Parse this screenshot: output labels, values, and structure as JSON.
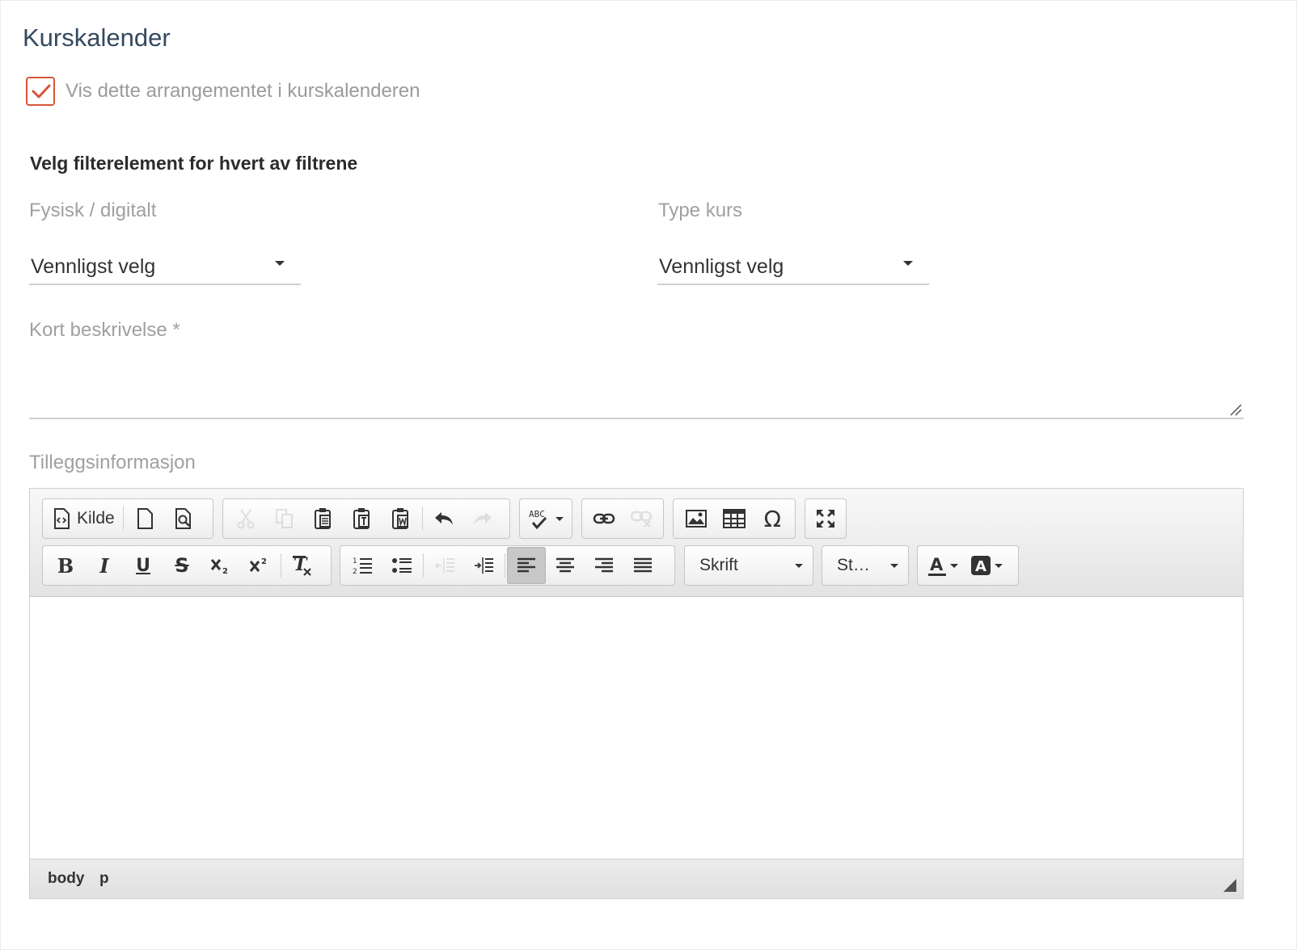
{
  "section": {
    "title": "Kurskalender"
  },
  "show_in_calendar": {
    "label": "Vis dette arrangementet i kurskalenderen",
    "checked": true,
    "accent": "#d6553a"
  },
  "filters": {
    "title": "Velg filterelement for hvert av filtrene",
    "physical_digital": {
      "label": "Fysisk / digitalt",
      "value": "Vennligst velg"
    },
    "course_type": {
      "label": "Type kurs",
      "value": "Vennligst velg"
    }
  },
  "short_description": {
    "label": "Kort beskrivelse *",
    "value": ""
  },
  "additional_info": {
    "label": "Tilleggsinformasjon",
    "toolbar": {
      "source_label": "Kilde",
      "font_label": "Skrift",
      "size_label": "St…",
      "row1_icons": [
        "source-icon",
        "new-page-icon",
        "preview-icon",
        "cut-icon",
        "copy-icon",
        "paste-icon",
        "paste-text-icon",
        "paste-word-icon",
        "undo-icon",
        "redo-icon",
        "spellcheck-icon",
        "link-icon",
        "unlink-icon",
        "image-icon",
        "table-icon",
        "special-char-icon",
        "maximize-icon"
      ],
      "row2_icons": [
        "bold-icon",
        "italic-icon",
        "underline-icon",
        "strikethrough-icon",
        "subscript-icon",
        "superscript-icon",
        "remove-format-icon",
        "numbered-list-icon",
        "bulleted-list-icon",
        "outdent-icon",
        "indent-icon",
        "align-left-icon",
        "align-center-icon",
        "align-right-icon",
        "justify-icon",
        "text-color-icon",
        "background-color-icon"
      ]
    },
    "path": [
      "body",
      "p"
    ]
  }
}
